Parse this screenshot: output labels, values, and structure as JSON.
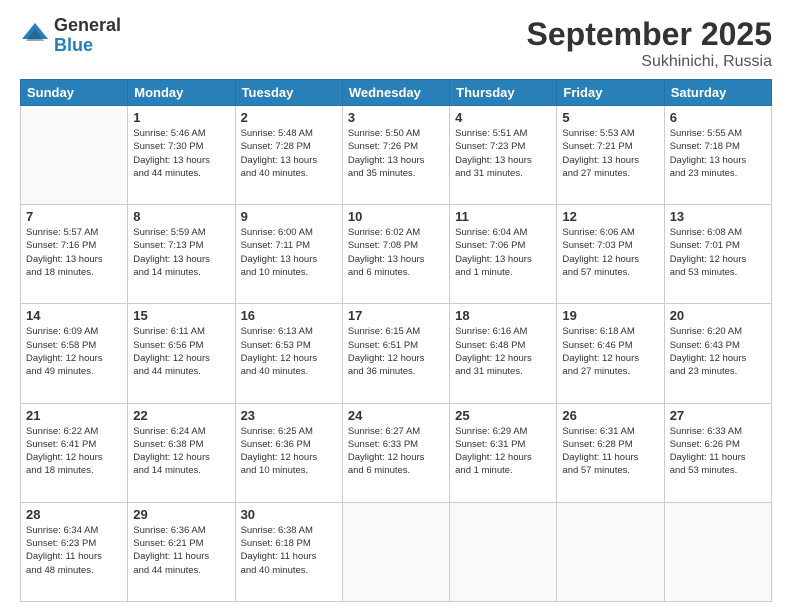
{
  "header": {
    "logo_general": "General",
    "logo_blue": "Blue",
    "title": "September 2025",
    "location": "Sukhinichi, Russia"
  },
  "days_of_week": [
    "Sunday",
    "Monday",
    "Tuesday",
    "Wednesday",
    "Thursday",
    "Friday",
    "Saturday"
  ],
  "weeks": [
    [
      {
        "day": "",
        "info": ""
      },
      {
        "day": "1",
        "info": "Sunrise: 5:46 AM\nSunset: 7:30 PM\nDaylight: 13 hours\nand 44 minutes."
      },
      {
        "day": "2",
        "info": "Sunrise: 5:48 AM\nSunset: 7:28 PM\nDaylight: 13 hours\nand 40 minutes."
      },
      {
        "day": "3",
        "info": "Sunrise: 5:50 AM\nSunset: 7:26 PM\nDaylight: 13 hours\nand 35 minutes."
      },
      {
        "day": "4",
        "info": "Sunrise: 5:51 AM\nSunset: 7:23 PM\nDaylight: 13 hours\nand 31 minutes."
      },
      {
        "day": "5",
        "info": "Sunrise: 5:53 AM\nSunset: 7:21 PM\nDaylight: 13 hours\nand 27 minutes."
      },
      {
        "day": "6",
        "info": "Sunrise: 5:55 AM\nSunset: 7:18 PM\nDaylight: 13 hours\nand 23 minutes."
      }
    ],
    [
      {
        "day": "7",
        "info": "Sunrise: 5:57 AM\nSunset: 7:16 PM\nDaylight: 13 hours\nand 18 minutes."
      },
      {
        "day": "8",
        "info": "Sunrise: 5:59 AM\nSunset: 7:13 PM\nDaylight: 13 hours\nand 14 minutes."
      },
      {
        "day": "9",
        "info": "Sunrise: 6:00 AM\nSunset: 7:11 PM\nDaylight: 13 hours\nand 10 minutes."
      },
      {
        "day": "10",
        "info": "Sunrise: 6:02 AM\nSunset: 7:08 PM\nDaylight: 13 hours\nand 6 minutes."
      },
      {
        "day": "11",
        "info": "Sunrise: 6:04 AM\nSunset: 7:06 PM\nDaylight: 13 hours\nand 1 minute."
      },
      {
        "day": "12",
        "info": "Sunrise: 6:06 AM\nSunset: 7:03 PM\nDaylight: 12 hours\nand 57 minutes."
      },
      {
        "day": "13",
        "info": "Sunrise: 6:08 AM\nSunset: 7:01 PM\nDaylight: 12 hours\nand 53 minutes."
      }
    ],
    [
      {
        "day": "14",
        "info": "Sunrise: 6:09 AM\nSunset: 6:58 PM\nDaylight: 12 hours\nand 49 minutes."
      },
      {
        "day": "15",
        "info": "Sunrise: 6:11 AM\nSunset: 6:56 PM\nDaylight: 12 hours\nand 44 minutes."
      },
      {
        "day": "16",
        "info": "Sunrise: 6:13 AM\nSunset: 6:53 PM\nDaylight: 12 hours\nand 40 minutes."
      },
      {
        "day": "17",
        "info": "Sunrise: 6:15 AM\nSunset: 6:51 PM\nDaylight: 12 hours\nand 36 minutes."
      },
      {
        "day": "18",
        "info": "Sunrise: 6:16 AM\nSunset: 6:48 PM\nDaylight: 12 hours\nand 31 minutes."
      },
      {
        "day": "19",
        "info": "Sunrise: 6:18 AM\nSunset: 6:46 PM\nDaylight: 12 hours\nand 27 minutes."
      },
      {
        "day": "20",
        "info": "Sunrise: 6:20 AM\nSunset: 6:43 PM\nDaylight: 12 hours\nand 23 minutes."
      }
    ],
    [
      {
        "day": "21",
        "info": "Sunrise: 6:22 AM\nSunset: 6:41 PM\nDaylight: 12 hours\nand 18 minutes."
      },
      {
        "day": "22",
        "info": "Sunrise: 6:24 AM\nSunset: 6:38 PM\nDaylight: 12 hours\nand 14 minutes."
      },
      {
        "day": "23",
        "info": "Sunrise: 6:25 AM\nSunset: 6:36 PM\nDaylight: 12 hours\nand 10 minutes."
      },
      {
        "day": "24",
        "info": "Sunrise: 6:27 AM\nSunset: 6:33 PM\nDaylight: 12 hours\nand 6 minutes."
      },
      {
        "day": "25",
        "info": "Sunrise: 6:29 AM\nSunset: 6:31 PM\nDaylight: 12 hours\nand 1 minute."
      },
      {
        "day": "26",
        "info": "Sunrise: 6:31 AM\nSunset: 6:28 PM\nDaylight: 11 hours\nand 57 minutes."
      },
      {
        "day": "27",
        "info": "Sunrise: 6:33 AM\nSunset: 6:26 PM\nDaylight: 11 hours\nand 53 minutes."
      }
    ],
    [
      {
        "day": "28",
        "info": "Sunrise: 6:34 AM\nSunset: 6:23 PM\nDaylight: 11 hours\nand 48 minutes."
      },
      {
        "day": "29",
        "info": "Sunrise: 6:36 AM\nSunset: 6:21 PM\nDaylight: 11 hours\nand 44 minutes."
      },
      {
        "day": "30",
        "info": "Sunrise: 6:38 AM\nSunset: 6:18 PM\nDaylight: 11 hours\nand 40 minutes."
      },
      {
        "day": "",
        "info": ""
      },
      {
        "day": "",
        "info": ""
      },
      {
        "day": "",
        "info": ""
      },
      {
        "day": "",
        "info": ""
      }
    ]
  ]
}
